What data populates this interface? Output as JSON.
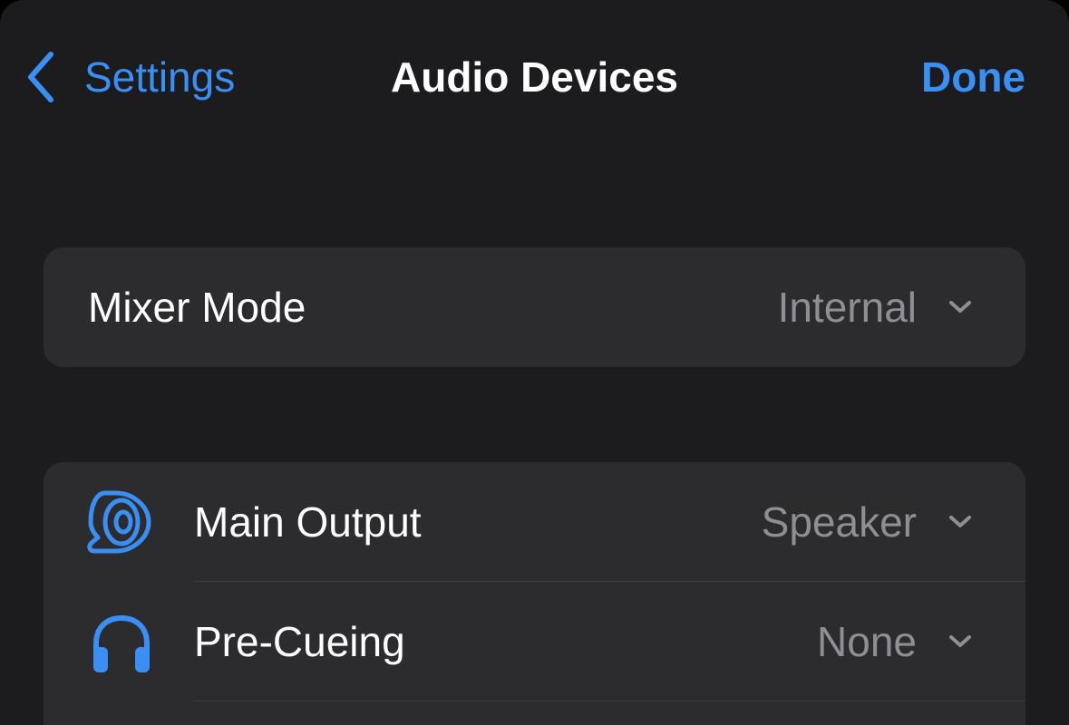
{
  "nav": {
    "back_label": "Settings",
    "title": "Audio Devices",
    "done_label": "Done"
  },
  "mixer": {
    "label": "Mixer Mode",
    "value": "Internal"
  },
  "devices": [
    {
      "icon": "speaker-icon",
      "label": "Main Output",
      "value": "Speaker"
    },
    {
      "icon": "headphones-icon",
      "label": "Pre-Cueing",
      "value": "None"
    }
  ],
  "colors": {
    "accent": "#3a8ff5",
    "background": "#1c1c1e",
    "card": "#2c2c2e",
    "secondary_text": "#8e8e93"
  }
}
